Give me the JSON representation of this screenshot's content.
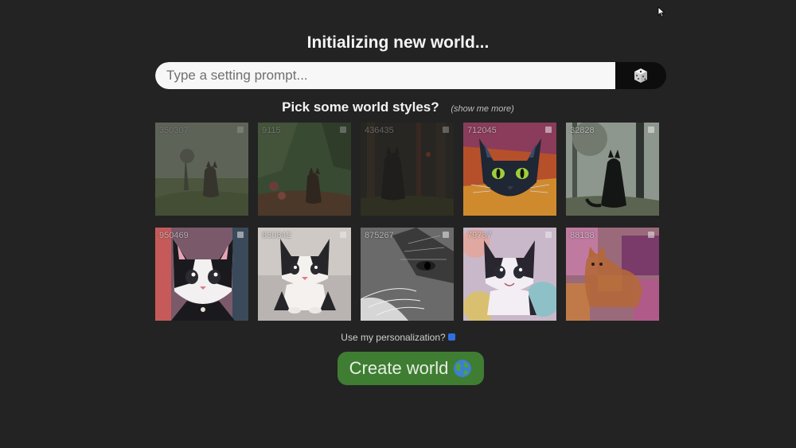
{
  "header": {
    "title": "Initializing new world..."
  },
  "prompt": {
    "placeholder": "Type a setting prompt...",
    "dice_icon": "dice-icon"
  },
  "styles": {
    "heading": "Pick some world styles?",
    "more_link": "(show me more)",
    "tiles": [
      {
        "seed": "350307",
        "subject": "cat in misty meadow",
        "dimmed": true
      },
      {
        "seed": "9115",
        "subject": "cat in forest clearing",
        "dimmed": true
      },
      {
        "seed": "436435",
        "subject": "cat in dark forest",
        "dimmed": true
      },
      {
        "seed": "712045",
        "subject": "black cat portrait",
        "dimmed": false
      },
      {
        "seed": "32828",
        "subject": "black cat silhouette in woods",
        "dimmed": false
      },
      {
        "seed": "950469",
        "subject": "cartoon tuxedo cat",
        "dimmed": false
      },
      {
        "seed": "830842",
        "subject": "chibi tuxedo kitten",
        "dimmed": false
      },
      {
        "seed": "875267",
        "subject": "sketch cat close-up",
        "dimmed": false
      },
      {
        "seed": "79737",
        "subject": "pastel chibi cat",
        "dimmed": false
      },
      {
        "seed": "88138",
        "subject": "abstract orange cat",
        "dimmed": false
      }
    ]
  },
  "personalization": {
    "label": "Use my personalization?",
    "checked": true
  },
  "create": {
    "label": "Create world",
    "icon": "globe-icon"
  },
  "colors": {
    "background": "#232323",
    "accent_green": "#3f7d32",
    "checkbox_blue": "#2f6fe0"
  }
}
